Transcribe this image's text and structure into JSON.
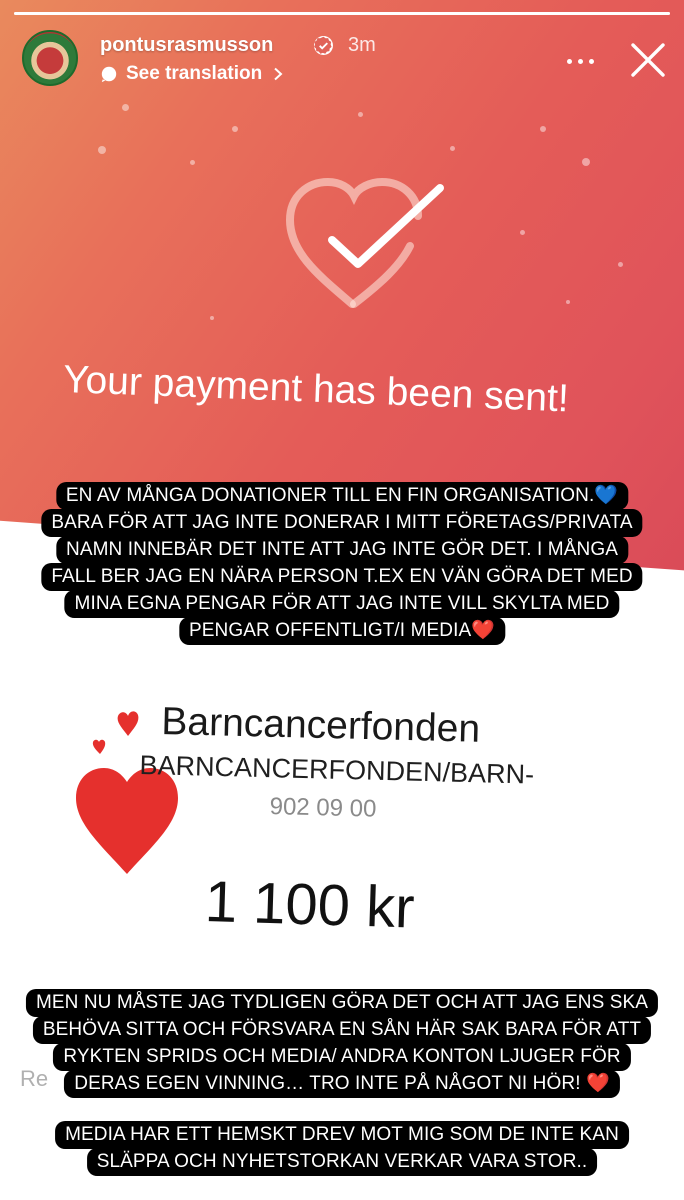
{
  "story": {
    "progress": 1.0,
    "author": {
      "username": "pontusrasmusson",
      "verified": true,
      "time_ago": "3m",
      "avatar_icon": "christmas-wreath-avatar"
    },
    "see_translation_label": "See translation",
    "icons": {
      "translate": "translate-bubble-icon",
      "chevron": "chevron-right-icon",
      "more": "more-dots-icon",
      "close": "close-icon",
      "verified": "verified-badge-icon"
    }
  },
  "receipt": {
    "status_icon": "heart-check-icon",
    "payment_message": "Your payment has been sent!",
    "recipient_name": "Barncancerfonden",
    "recipient_subtitle": "BARNCANCERFONDEN/BARN-",
    "recipient_number": "902 09 00",
    "amount": "1 100 kr",
    "reference_stub": "Re"
  },
  "captions": {
    "top": [
      "EN AV MÅNGA DONATIONER TILL EN FIN ORGANISATION.💙",
      "BARA FÖR ATT JAG INTE DONERAR I MITT FÖRETAGS/PRIVATA",
      "NAMN INNEBÄR DET INTE ATT JAG INTE GÖR DET. I MÅNGA",
      "FALL BER JAG EN NÄRA PERSON T.EX EN VÄN GÖRA DET MED",
      "MINA EGNA PENGAR FÖR ATT JAG INTE VILL SKYLTA MED",
      "PENGAR OFFENTLIGT/I MEDIA❤️"
    ],
    "middle": [
      "MEN NU MÅSTE JAG TYDLIGEN GÖRA DET OCH ATT JAG ENS SKA",
      "BEHÖVA SITTA OCH FÖRSVARA EN SÅN HÄR SAK BARA FÖR ATT",
      "RYKTEN SPRIDS OCH MEDIA/ ANDRA KONTON LJUGER FÖR",
      "DERAS EGEN VINNING… TRO INTE PÅ NÅGOT NI HÖR! ❤️"
    ],
    "bottom": [
      "MEDIA HAR ETT HEMSKT DREV MOT MIG SOM DE INTE KAN",
      "SLÄPPA OCH NYHETSTORKAN VERKAR VARA STOR.."
    ]
  },
  "sticker": {
    "icon": "red-hearts-sticker",
    "color": "#e5302d"
  },
  "colors": {
    "gradient_start": "#e98a5d",
    "gradient_end": "#d94a58",
    "caption_bg": "#000000",
    "caption_text": "#ffffff"
  }
}
